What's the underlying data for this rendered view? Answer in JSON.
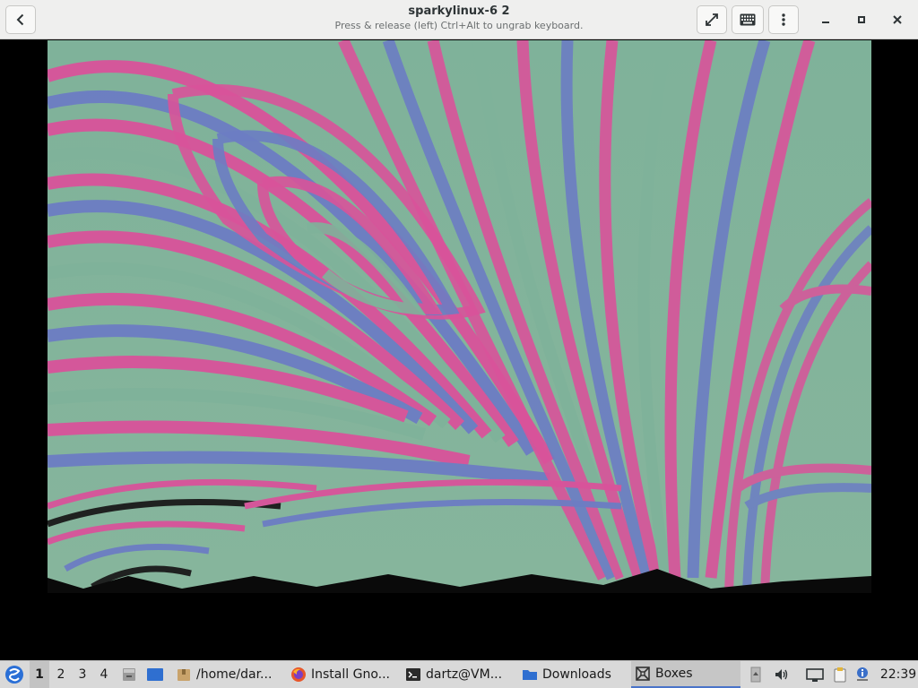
{
  "window": {
    "title": "sparkylinux-6 2",
    "subtitle": "Press & release (left) Ctrl+Alt to ungrab keyboard."
  },
  "header_icons": {
    "back": "go-back-icon",
    "fullscreen": "fullscreen-icon",
    "keyboard": "keyboard-icon",
    "menu": "kebab-menu-icon",
    "minimize": "minimize-icon",
    "maximize": "maximize-icon",
    "close": "close-icon"
  },
  "taskbar": {
    "workspaces": [
      "1",
      "2",
      "3",
      "4"
    ],
    "active_workspace": "1",
    "tasks": [
      {
        "label": "/home/dar...",
        "icon": "file-manager-icon"
      },
      {
        "label": "Install Gno...",
        "icon": "firefox-icon"
      },
      {
        "label": "dartz@VM...",
        "icon": "terminal-icon"
      },
      {
        "label": "Downloads",
        "icon": "folder-icon"
      },
      {
        "label": "Boxes",
        "icon": "boxes-icon"
      }
    ],
    "active_task": "Boxes",
    "clock": "22:39"
  },
  "colors": {
    "accent": "#4a74c9",
    "wallpaper_pink": "#d9539a",
    "wallpaper_green": "#82b29a",
    "wallpaper_blue": "#6c7dc4"
  }
}
